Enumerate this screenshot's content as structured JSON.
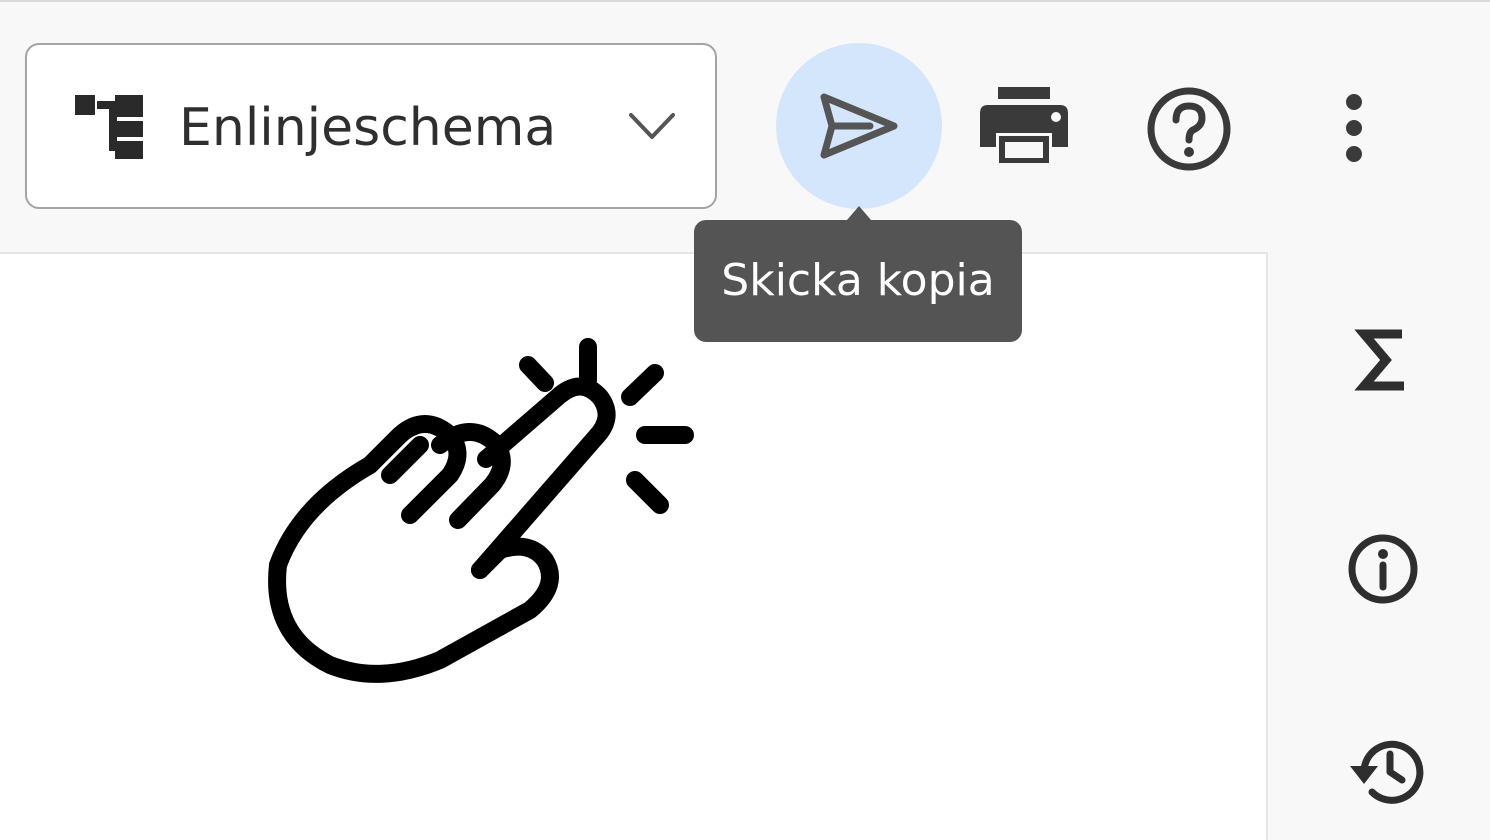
{
  "toolbar": {
    "view_select": {
      "label": "Enlinjeschema",
      "icon": "hierarchy-tree-icon",
      "dropdown_icon": "chevron-down-icon"
    },
    "buttons": [
      {
        "icon": "send-icon",
        "state": "hover"
      },
      {
        "icon": "print-icon"
      },
      {
        "icon": "help-icon"
      },
      {
        "icon": "more-vertical-icon"
      }
    ],
    "tooltip": "Skicka kopia"
  },
  "side_rail": {
    "buttons": [
      {
        "icon": "sigma-icon"
      },
      {
        "icon": "info-icon"
      },
      {
        "icon": "history-icon"
      }
    ]
  },
  "overlay": {
    "icon": "tap-hand-icon"
  },
  "colors": {
    "send_hover_bg": "#d3e6fb",
    "tooltip_bg": "#545454",
    "icon": "#3a3a3a",
    "toolbar_bg": "#f8f8f8"
  }
}
